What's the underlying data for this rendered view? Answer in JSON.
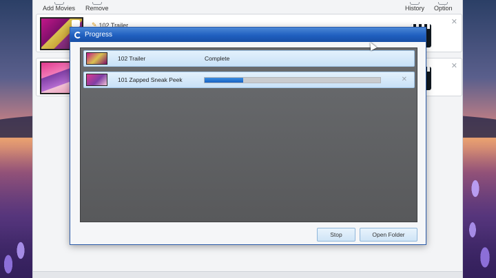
{
  "toolbar": {
    "add_movies": "Add Movies",
    "remove": "Remove",
    "history": "History",
    "option": "Option"
  },
  "movies": [
    {
      "title": "102 Trailer"
    },
    {
      "title": ""
    }
  ],
  "dialog": {
    "title": "Progress",
    "tasks": [
      {
        "name": "102 Trailer",
        "status": "Complete"
      },
      {
        "name": "101 Zapped Sneak Peek",
        "progress": 0.22
      }
    ],
    "stop_label": "Stop",
    "open_folder_label": "Open Folder"
  },
  "colors": {
    "title_bar": "#1f5fbf",
    "progress_fill": "#1763c4",
    "row_highlight": "#c8e1f7"
  },
  "icons": {
    "progress_spinner": "spinner-icon",
    "cancel": "close-icon",
    "clapperboard": "clapperboard-icon"
  }
}
